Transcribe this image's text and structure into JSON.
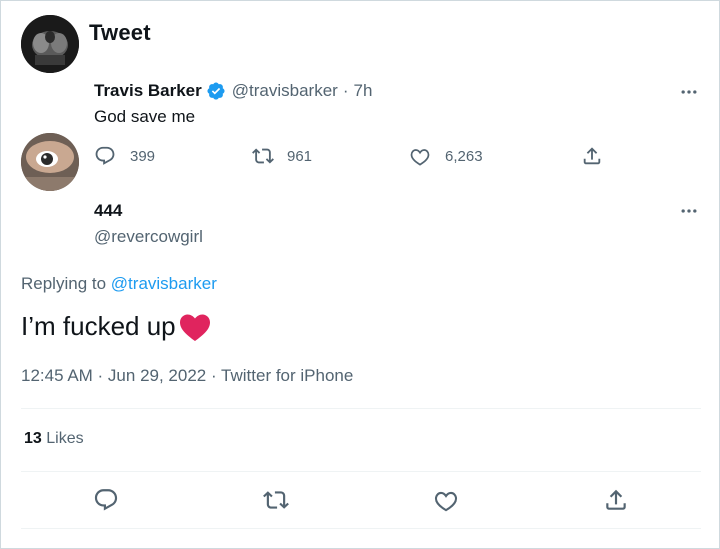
{
  "header": {
    "title": "Tweet"
  },
  "parent_tweet": {
    "display_name": "Travis Barker",
    "handle": "@travisbarker",
    "separator": "·",
    "time": "7h",
    "text": "God save me",
    "stats": {
      "replies": "399",
      "retweets": "961",
      "likes": "6,263"
    }
  },
  "reply_tweet": {
    "display_name": "444",
    "handle": "@revercowgirl",
    "replying_prefix": "Replying to",
    "replying_to": "@travisbarker",
    "text": "I’m fucked up",
    "timestamp": "12:45 AM · Jun 29, 2022 · ",
    "source": "Twitter for iPhone",
    "likes_count": "13",
    "likes_label": " Likes"
  },
  "colors": {
    "accent": "#1d9bf0",
    "heart": "#e0245e",
    "muted": "#536471"
  },
  "icons": [
    "back-arrow-icon",
    "verified-badge-icon",
    "more-icon",
    "reply-icon",
    "retweet-icon",
    "like-icon",
    "share-icon",
    "heart-emoji-icon"
  ]
}
